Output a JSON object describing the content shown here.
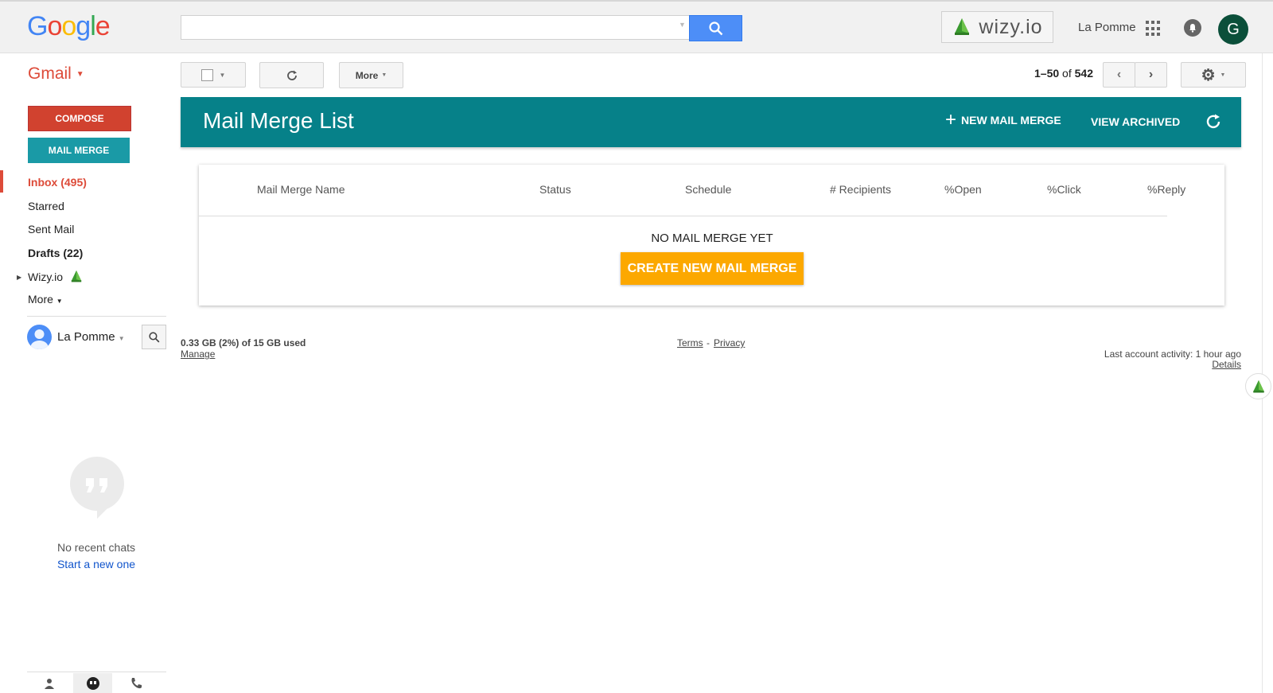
{
  "topbar": {
    "logo": "Google",
    "search_placeholder": "",
    "wizy_label": "wizy.io",
    "username": "La Pomme",
    "avatar_letter": "G"
  },
  "toolbar": {
    "app_label": "Gmail",
    "more_label": "More",
    "page_range": "1–50",
    "page_of": "of",
    "page_total": "542"
  },
  "sidebar": {
    "compose_label": "COMPOSE",
    "mail_merge_label": "MAIL MERGE",
    "items": [
      {
        "label": "Inbox (495)"
      },
      {
        "label": "Starred"
      },
      {
        "label": "Sent Mail"
      },
      {
        "label": "Drafts (22)"
      },
      {
        "label": "Wizy.io"
      },
      {
        "label": "More"
      }
    ],
    "hangouts_user": "La Pomme",
    "no_chats": "No recent chats",
    "start_chat": "Start a new one"
  },
  "main": {
    "title": "Mail Merge List",
    "new_merge_label": "NEW MAIL MERGE",
    "view_archived_label": "VIEW ARCHIVED",
    "columns": [
      "Mail Merge Name",
      "Status",
      "Schedule",
      "# Recipients",
      "%Open",
      "%Click",
      "%Reply"
    ],
    "empty_message": "NO MAIL MERGE YET",
    "create_label": "CREATE NEW MAIL MERGE"
  },
  "footer": {
    "storage": "0.33 GB (2%) of 15 GB used",
    "manage": "Manage",
    "terms": "Terms",
    "separator": "-",
    "privacy": "Privacy",
    "last_activity": "Last account activity: 1 hour ago",
    "details": "Details"
  },
  "colors": {
    "header_teal": "#068189",
    "compose_red": "#d1422f",
    "mail_merge_teal": "#1a9aa6",
    "create_orange": "#fca800",
    "search_blue": "#4d8ef7",
    "inbox_red": "#dd4b39"
  },
  "icons": {
    "search": "search-icon",
    "apps": "apps-grid-icon",
    "notifications": "bell-icon",
    "refresh": "refresh-icon",
    "settings": "gear-icon",
    "wizy": "wizy-tree-icon"
  }
}
